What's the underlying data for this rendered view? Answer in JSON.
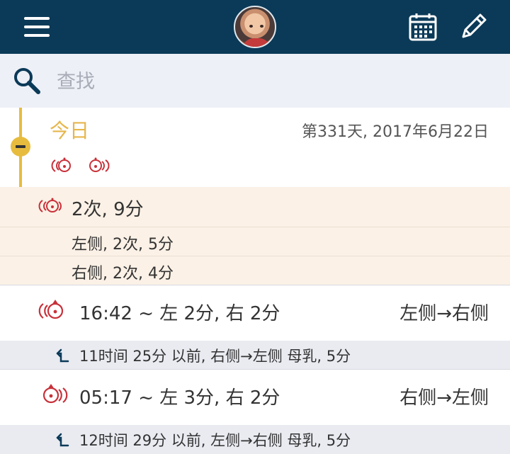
{
  "search": {
    "placeholder": "查找"
  },
  "today": {
    "label": "今日",
    "day_info": "第331天, 2017年6月22日"
  },
  "summary": {
    "total": "2次, 9分",
    "left": "左侧, 2次, 5分",
    "right": "右侧, 2次, 4分"
  },
  "entries": [
    {
      "time": "16:42 ~ 左 2分, 右 2分",
      "direction": "左侧→右侧",
      "note": "11时间 25分 以前, 右侧→左侧 母乳, 5分"
    },
    {
      "time": "05:17 ~ 左 3分, 右 2分",
      "direction": "右侧→左侧",
      "note": "12时间 29分 以前, 左侧→右侧 母乳, 5分"
    }
  ],
  "colors": {
    "topbar": "#0b3a58",
    "accent_yellow": "#e7bc3e",
    "feeding_red": "#c8313a",
    "summary_bg": "#fbf1e6",
    "search_bg": "#eef0f7"
  },
  "icons": {
    "menu": "hamburger-icon",
    "calendar": "calendar-icon",
    "edit": "pencil-icon",
    "search": "search-icon",
    "feeding": "breastfeeding-icon",
    "previous": "return-arrow-icon"
  }
}
